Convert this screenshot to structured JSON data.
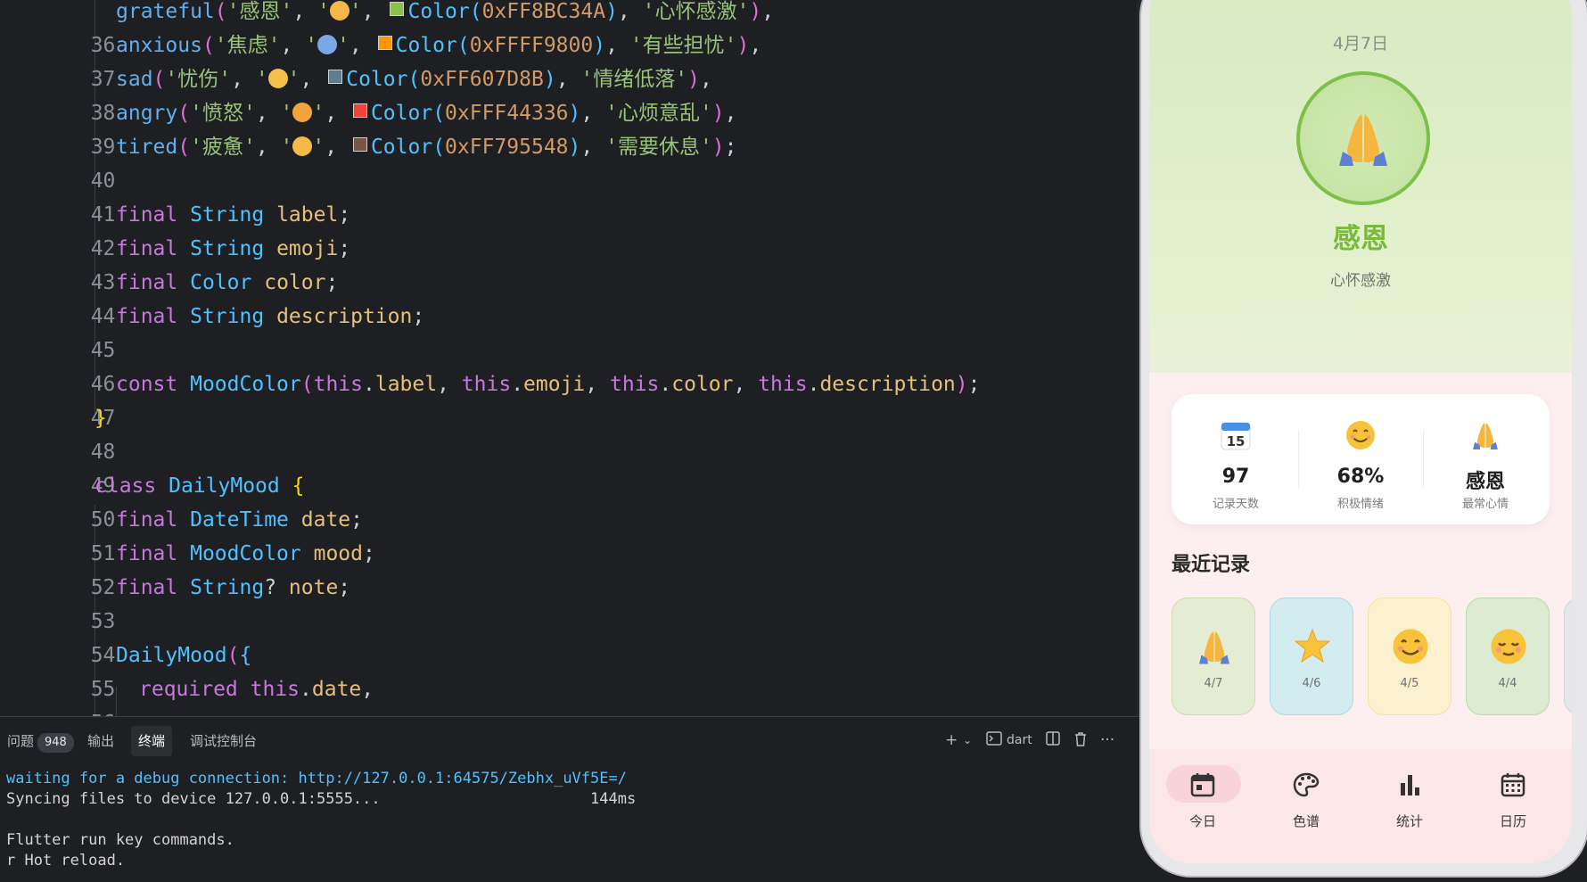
{
  "editor": {
    "lines": [
      {
        "n": "36",
        "code": "grateful('感恩', '🙏', Color(0xFF8BC34A), '心怀感激'),"
      },
      {
        "n": "37",
        "code": "anxious('焦虑', '😨', Color(0xFFFF9800), '有些担忧'),"
      },
      {
        "n": "38",
        "code": "sad('忧伤', '😳', Color(0xFF607D8B), '情绪低落'),"
      },
      {
        "n": "39",
        "code": "angry('愤怒', '😠', Color(0xFFF44336), '心烦意乱'),"
      },
      {
        "n": "40",
        "code": "tired('疲惫', '😴', Color(0xFF795548), '需要休息');"
      },
      {
        "n": "41",
        "code": ""
      },
      {
        "n": "42",
        "code": "final String label;"
      },
      {
        "n": "43",
        "code": "final String emoji;"
      },
      {
        "n": "44",
        "code": "final Color color;"
      },
      {
        "n": "45",
        "code": "final String description;"
      },
      {
        "n": "46",
        "code": ""
      },
      {
        "n": "47",
        "code": "const MoodColor(this.label, this.emoji, this.color, this.description);"
      },
      {
        "n": "48",
        "code": "}"
      },
      {
        "n": "49",
        "code": ""
      },
      {
        "n": "50",
        "code": "class DailyMood {"
      },
      {
        "n": "51",
        "code": "final DateTime date;"
      },
      {
        "n": "52",
        "code": "final MoodColor mood;"
      },
      {
        "n": "53",
        "code": "final String? note;"
      },
      {
        "n": "54",
        "code": ""
      },
      {
        "n": "55",
        "code": "DailyMood({"
      },
      {
        "n": "56",
        "code": "required this.date,"
      }
    ],
    "swatch_colors": [
      "#8BC34A",
      "#FF9800",
      "#607D8B",
      "#F44336",
      "#795548"
    ]
  },
  "panel": {
    "tabs": {
      "problems": "问题",
      "problems_count": "948",
      "output": "输出",
      "terminal": "终端",
      "debug_console": "调试控制台"
    },
    "shell_label": "dart",
    "terminal_lines": [
      "waiting for a debug connection: http://127.0.0.1:64575/Zebhx_uVf5E=/",
      "Syncing files to device 127.0.0.1:5555...                       144ms",
      "",
      "Flutter run key commands.",
      "r Hot reload."
    ]
  },
  "app": {
    "hero": {
      "date": "4月7日",
      "emoji": "praying-hands",
      "label": "感恩",
      "description": "心怀感激",
      "accent": "#7cc04a"
    },
    "stats": [
      {
        "icon": "calendar-15-icon",
        "value": "97",
        "label": "记录天数"
      },
      {
        "icon": "smile-icon",
        "value": "68%",
        "label": "积极情绪"
      },
      {
        "icon": "praying-hands-icon",
        "value": "感恩",
        "label": "最常心情"
      }
    ],
    "recent_title": "最近记录",
    "recent": [
      {
        "date": "4/7",
        "emoji": "praying-hands",
        "bg": "#e4ecd3",
        "border": "#cbdcae"
      },
      {
        "date": "4/6",
        "emoji": "star",
        "bg": "#d2ecf0",
        "border": "#a7dbe6"
      },
      {
        "date": "4/5",
        "emoji": "smile",
        "bg": "#fbf1cf",
        "border": "#f4e2a6"
      },
      {
        "date": "4/4",
        "emoji": "relieved",
        "bg": "#dcebd2",
        "border": "#bcd8ac"
      },
      {
        "date": "",
        "emoji": "partial",
        "bg": "#e4e7ea",
        "border": "#cfd4d8"
      }
    ],
    "nav": [
      {
        "label": "今日",
        "icon": "calendar-today-icon",
        "active": true
      },
      {
        "label": "色谱",
        "icon": "palette-icon",
        "active": false
      },
      {
        "label": "统计",
        "icon": "bar-chart-icon",
        "active": false
      },
      {
        "label": "日历",
        "icon": "calendar-month-icon",
        "active": false
      }
    ]
  }
}
